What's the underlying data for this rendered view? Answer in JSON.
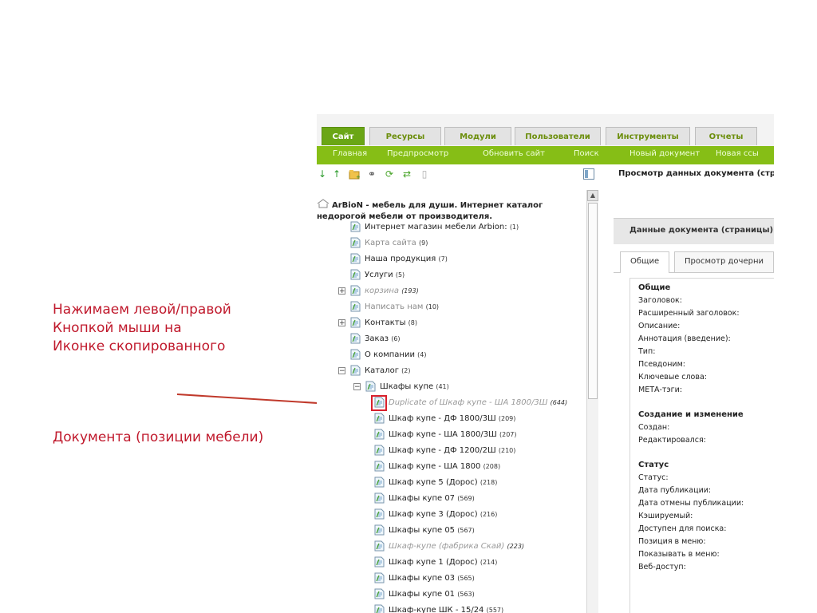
{
  "annotation": {
    "lines_top": [
      "Нажимаем левой/правой",
      "Кнопкой мыши на",
      "Иконке скопированного"
    ],
    "line_bottom": "Документа (позиции мебели)"
  },
  "tabs": [
    "Сайт",
    "Ресурсы",
    "Модули",
    "Пользователи",
    "Инструменты",
    "Отчеты"
  ],
  "menu": [
    "Главная",
    "Предпросмотр",
    "Обновить сайт",
    "Поиск",
    "Новый документ",
    "Новая ссы"
  ],
  "toolbar_icons": [
    "expand-down-icon",
    "collapse-up-icon",
    "new-folder-icon",
    "link-icon",
    "refresh-icon",
    "sort-icon",
    "trash-icon",
    "panel-toggle-icon"
  ],
  "tree": {
    "root": "ArBioN - мебель для души. Интернет каталог недорогой мебели от производителя.",
    "items": [
      {
        "label": "Интернет магазин мебели Arbion:",
        "count": "(1)"
      },
      {
        "label": "Карта сайта",
        "count": "(9)"
      },
      {
        "label": "Наша продукция",
        "count": "(7)"
      },
      {
        "label": "Услуги",
        "count": "(5)"
      },
      {
        "label": "корзина",
        "count": "(193)"
      },
      {
        "label": "Написать нам",
        "count": "(10)"
      },
      {
        "label": "Контакты",
        "count": "(8)"
      },
      {
        "label": "Заказ",
        "count": "(6)"
      },
      {
        "label": "О компании",
        "count": "(4)"
      },
      {
        "label": "Каталог",
        "count": "(2)"
      },
      {
        "label": "Шкафы купе",
        "count": "(41)"
      },
      {
        "label": "Duplicate of Шкаф купе - ША 1800/3Ш",
        "count": "(644)"
      },
      {
        "label": "Шкаф купе - ДФ 1800/3Ш",
        "count": "(209)"
      },
      {
        "label": "Шкаф купе - ША 1800/3Ш",
        "count": "(207)"
      },
      {
        "label": "Шкаф купе - ДФ 1200/2Ш",
        "count": "(210)"
      },
      {
        "label": "Шкаф купе - ША 1800",
        "count": "(208)"
      },
      {
        "label": "Шкаф купе 5 (Дорос)",
        "count": "(218)"
      },
      {
        "label": "Шкафы купе 07",
        "count": "(569)"
      },
      {
        "label": "Шкаф купе 3 (Дорос)",
        "count": "(216)"
      },
      {
        "label": "Шкафы купе 05",
        "count": "(567)"
      },
      {
        "label": "Шкаф-купе (фабрика Скай)",
        "count": "(223)"
      },
      {
        "label": "Шкаф купе 1 (Дорос)",
        "count": "(214)"
      },
      {
        "label": "Шкафы купе 03",
        "count": "(565)"
      },
      {
        "label": "Шкафы купе 01",
        "count": "(563)"
      },
      {
        "label": "Шкаф-купе ШК - 15/24",
        "count": "(557)"
      }
    ]
  },
  "right": {
    "title": "Просмотр данных документа (стр",
    "panel_title": "Данные документа (страницы)",
    "subtabs": [
      "Общие",
      "Просмотр дочерни"
    ],
    "fields": [
      {
        "text": "Общие",
        "head": true
      },
      {
        "text": "Заголовок:"
      },
      {
        "text": "Расширенный заголовок:"
      },
      {
        "text": "Описание:"
      },
      {
        "text": "Аннотация (введение):"
      },
      {
        "text": "Тип:"
      },
      {
        "text": "Псевдоним:"
      },
      {
        "text": "Ключевые слова:"
      },
      {
        "text": "МЕТА-тэги:"
      },
      {
        "text": "Создание и изменение",
        "head": true
      },
      {
        "text": "Создан:"
      },
      {
        "text": "Редактировался:"
      },
      {
        "text": "Статус",
        "head": true
      },
      {
        "text": "Статус:"
      },
      {
        "text": "Дата публикации:"
      },
      {
        "text": "Дата отмены публикации:"
      },
      {
        "text": "Кэшируемый:"
      },
      {
        "text": "Доступен для поиска:"
      },
      {
        "text": "Позиция в меню:"
      },
      {
        "text": "Показывать в меню:"
      },
      {
        "text": "Веб-доступ:"
      }
    ]
  },
  "colors": {
    "accent_green": "#86be16",
    "tab_active": "#6aa615",
    "highlight_red": "#d8202c",
    "annotation_red": "#c0192c"
  }
}
